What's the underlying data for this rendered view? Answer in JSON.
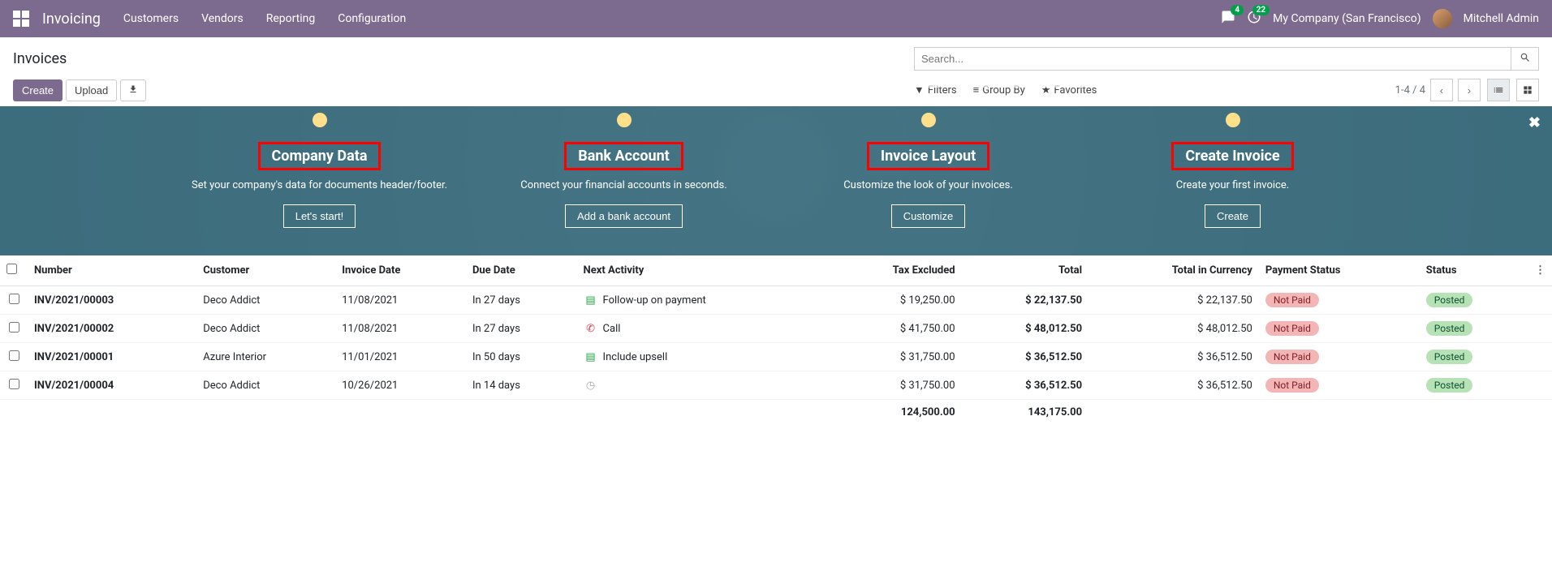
{
  "nav": {
    "brand": "Invoicing",
    "menu": [
      "Customers",
      "Vendors",
      "Reporting",
      "Configuration"
    ],
    "messages_badge": "4",
    "activities_badge": "22",
    "company": "My Company (San Francisco)",
    "user": "Mitchell Admin"
  },
  "page": {
    "title": "Invoices",
    "create": "Create",
    "upload": "Upload",
    "search_placeholder": "Search...",
    "filters": "Filters",
    "groupby": "Group By",
    "favorites": "Favorites",
    "pager": "1-4 / 4"
  },
  "onboard": {
    "steps": [
      {
        "title": "Company Data",
        "desc": "Set your company's data for documents header/footer.",
        "button": "Let's start!"
      },
      {
        "title": "Bank Account",
        "desc": "Connect your financial accounts in seconds.",
        "button": "Add a bank account"
      },
      {
        "title": "Invoice Layout",
        "desc": "Customize the look of your invoices.",
        "button": "Customize"
      },
      {
        "title": "Create Invoice",
        "desc": "Create your first invoice.",
        "button": "Create"
      }
    ]
  },
  "table": {
    "headers": {
      "number": "Number",
      "customer": "Customer",
      "invoice_date": "Invoice Date",
      "due_date": "Due Date",
      "next_activity": "Next Activity",
      "tax_excluded": "Tax Excluded",
      "total": "Total",
      "total_currency": "Total in Currency",
      "payment_status": "Payment Status",
      "status": "Status"
    },
    "rows": [
      {
        "number": "INV/2021/00003",
        "customer": "Deco Addict",
        "invoice_date": "11/08/2021",
        "due_date": "In 27 days",
        "activity_icon": "green",
        "activity": "Follow-up on payment",
        "tax_excluded": "$ 19,250.00",
        "total": "$ 22,137.50",
        "total_currency": "$ 22,137.50",
        "payment_status": "Not Paid",
        "status": "Posted"
      },
      {
        "number": "INV/2021/00002",
        "customer": "Deco Addict",
        "invoice_date": "11/08/2021",
        "due_date": "In 27 days",
        "activity_icon": "phone",
        "activity": "Call",
        "tax_excluded": "$ 41,750.00",
        "total": "$ 48,012.50",
        "total_currency": "$ 48,012.50",
        "payment_status": "Not Paid",
        "status": "Posted"
      },
      {
        "number": "INV/2021/00001",
        "customer": "Azure Interior",
        "invoice_date": "11/01/2021",
        "due_date": "In 50 days",
        "activity_icon": "green",
        "activity": "Include upsell",
        "tax_excluded": "$ 31,750.00",
        "total": "$ 36,512.50",
        "total_currency": "$ 36,512.50",
        "payment_status": "Not Paid",
        "status": "Posted"
      },
      {
        "number": "INV/2021/00004",
        "customer": "Deco Addict",
        "invoice_date": "10/26/2021",
        "due_date": "In 14 days",
        "activity_icon": "clock",
        "activity": "",
        "tax_excluded": "$ 31,750.00",
        "total": "$ 36,512.50",
        "total_currency": "$ 36,512.50",
        "payment_status": "Not Paid",
        "status": "Posted"
      }
    ],
    "totals": {
      "tax_excluded": "124,500.00",
      "total": "143,175.00"
    }
  }
}
